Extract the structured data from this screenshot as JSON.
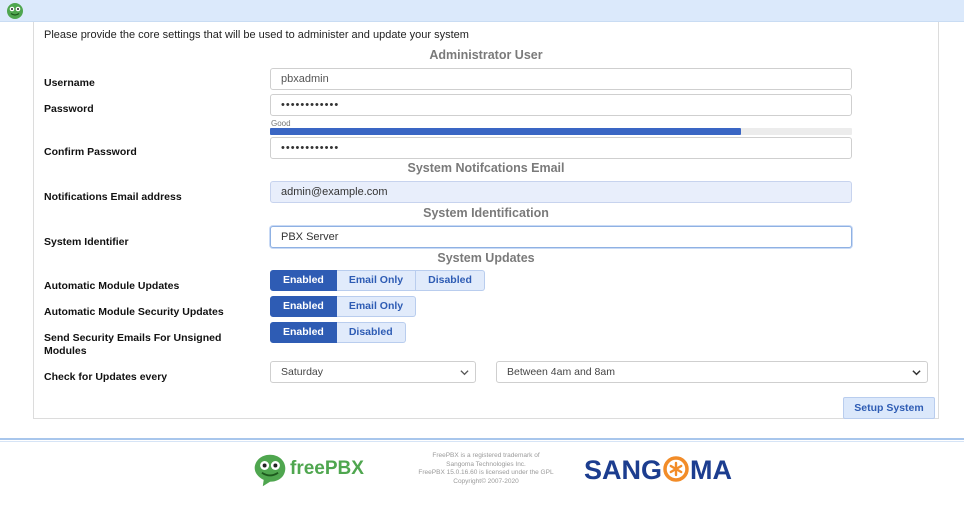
{
  "intro": "Please provide the core settings that will be used to administer and update your system",
  "sections": {
    "admin": "Administrator User",
    "email": "System Notifcations Email",
    "ident": "System Identification",
    "updates": "System Updates"
  },
  "fields": {
    "username": {
      "label": "Username",
      "value": "pbxadmin"
    },
    "password": {
      "label": "Password",
      "value": "••••••••••••",
      "strength_label": "Good",
      "strength": 0.81
    },
    "confirm_password": {
      "label": "Confirm Password",
      "value": "••••••••••••"
    },
    "email": {
      "label": "Notifications Email address",
      "value": "admin@example.com"
    },
    "system_identifier": {
      "label": "System Identifier",
      "value": "PBX Server"
    }
  },
  "updates": {
    "module_updates": {
      "label": "Automatic Module Updates",
      "options": [
        "Enabled",
        "Email Only",
        "Disabled"
      ],
      "selected": "Enabled"
    },
    "security_updates": {
      "label": "Automatic Module Security Updates",
      "options": [
        "Enabled",
        "Email Only"
      ],
      "selected": "Enabled"
    },
    "unsigned_emails": {
      "label": "Send Security Emails For Unsigned Modules",
      "options": [
        "Enabled",
        "Disabled"
      ],
      "selected": "Enabled"
    },
    "check_every": {
      "label": "Check for Updates every",
      "day": "Saturday",
      "time": "Between 4am and 8am"
    }
  },
  "setup_button": "Setup System",
  "footer": {
    "brand": "freePBX",
    "legal": [
      "FreePBX is a registered trademark of",
      "Sangoma Technologies Inc.",
      "FreePBX 15.0.16.60 is licensed under the GPL",
      "Copyright© 2007-2020"
    ],
    "sangoma_left": "SANG",
    "sangoma_right": "MA"
  },
  "colors": {
    "accent": "#2e5cb4",
    "topbar": "#dbe9fb",
    "freepbx_green": "#4fa64f",
    "sangoma_blue": "#1c3d8f",
    "sangoma_orange": "#f28c28"
  }
}
